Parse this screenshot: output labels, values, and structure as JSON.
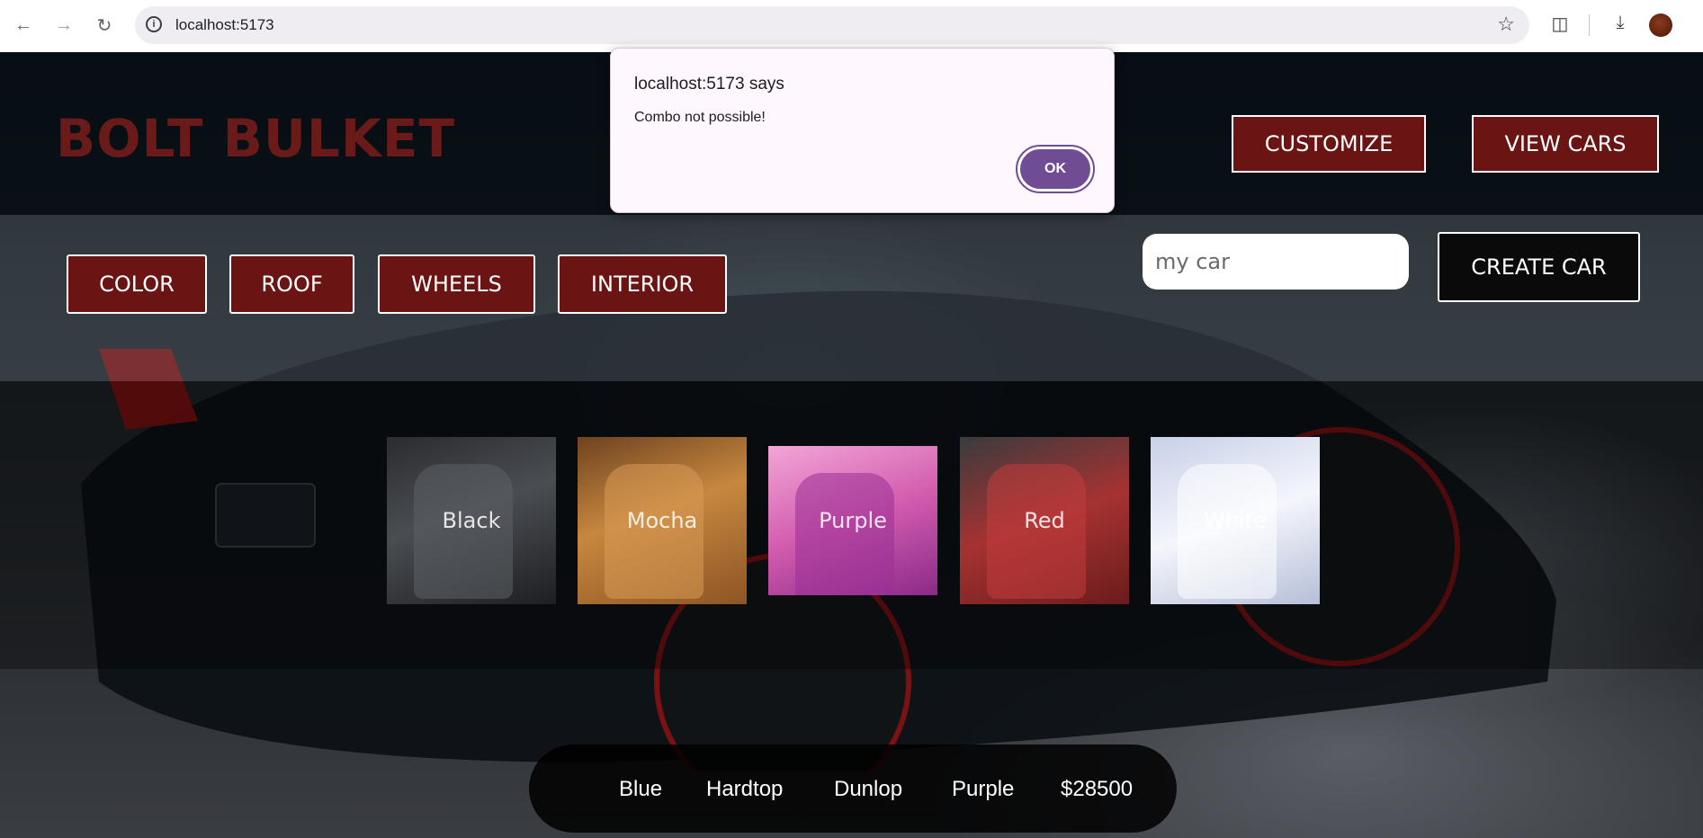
{
  "browser": {
    "url": "localhost:5173",
    "icons": [
      "back-arrow-icon",
      "forward-arrow-icon",
      "reload-icon",
      "site-info-icon",
      "bookmark-star-icon",
      "extensions-icon",
      "download-icon",
      "profile-avatar"
    ]
  },
  "header": {
    "logo": "BOLT BULKET",
    "nav": [
      "CUSTOMIZE",
      "VIEW CARS"
    ]
  },
  "options": {
    "tabs": [
      "COLOR",
      "ROOF",
      "WHEELS",
      "INTERIOR"
    ],
    "name_input_value": "my car",
    "create_label": "CREATE CAR"
  },
  "interiors": [
    {
      "label": "Black",
      "color": "#3a3c40"
    },
    {
      "label": "Mocha",
      "color": "#b5773a"
    },
    {
      "label": "Purple",
      "color": "#d96cb8"
    },
    {
      "label": "Red",
      "color": "#9e3030"
    },
    {
      "label": "White",
      "color": "#dfe3ef"
    }
  ],
  "summary": {
    "exterior": "Blue",
    "roof": "Hardtop",
    "wheels": "Dunlop",
    "interior": "Purple",
    "price": "$28500"
  },
  "alert": {
    "title": "localhost:5173 says",
    "message": "Combo not possible!",
    "ok": "OK"
  },
  "colors": {
    "brand": "#6b1414",
    "dialog_button": "#6f4c94"
  }
}
